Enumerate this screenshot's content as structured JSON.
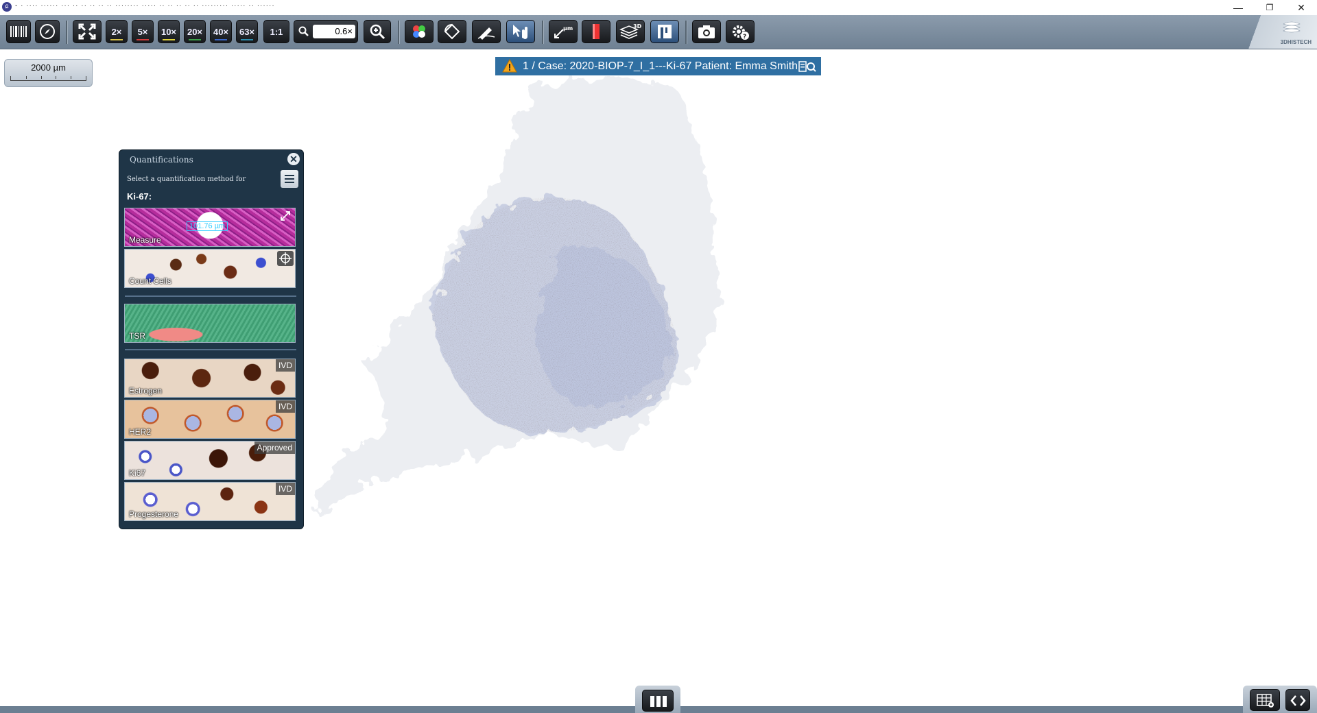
{
  "window": {
    "title": "- · ···· ······ ··· ·· ·· ·· ·· ·· ········ ····· ·· ·· ·· ·· ·· ········· ····· ·· ······",
    "minimize": "—",
    "restore": "❐",
    "close": "✕"
  },
  "toolbar": {
    "buttons": [
      {
        "id": "barcode",
        "icon": "barcode-icon"
      },
      {
        "id": "navigator",
        "icon": "compass-icon"
      },
      {
        "id": "fit",
        "icon": "fullscreen-icon"
      },
      {
        "id": "z2",
        "label": "2×",
        "color": "#d8c24a"
      },
      {
        "id": "z5",
        "label": "5×",
        "color": "#d23b3b"
      },
      {
        "id": "z10",
        "label": "10×",
        "color": "#e0d23c"
      },
      {
        "id": "z20",
        "label": "20×",
        "color": "#3ca24a"
      },
      {
        "id": "z40",
        "label": "40×",
        "color": "#3a66c8"
      },
      {
        "id": "z63",
        "label": "63×",
        "color": "#2d8fb0"
      },
      {
        "id": "z11",
        "label": "1:1"
      }
    ],
    "zoom_value": "0.6×",
    "tools": [
      "magnifier-icon",
      "color-channels-icon",
      "rotate-icon",
      "annotation-pen-icon",
      "pan-hand-icon",
      "measure-um-icon",
      "marker-icon",
      "layers-3d-icon",
      "panel-icon",
      "camera-icon",
      "settings-help-icon"
    ],
    "brand_label": "3DHISTECH"
  },
  "scalebar": {
    "label": "2000 µm"
  },
  "case_banner": {
    "text": "1 / Case: 2020-BIOP-7_I_1---Ki-67 Patient: Emma Smith"
  },
  "quantifications": {
    "title": "Quantifications",
    "subtitle": "Select a quantification method for",
    "stain": "Ki-67:",
    "measure_readout": "101.76 µm",
    "items": [
      {
        "label": "Measure",
        "badge": ""
      },
      {
        "label": "Count Cells",
        "badge": ""
      },
      {
        "label": "TSR",
        "badge": ""
      },
      {
        "label": "Estrogen",
        "badge": "IVD"
      },
      {
        "label": "HER2",
        "badge": "IVD"
      },
      {
        "label": "Ki67",
        "badge": "Approved"
      },
      {
        "label": "Progesterone",
        "badge": "IVD"
      }
    ]
  }
}
